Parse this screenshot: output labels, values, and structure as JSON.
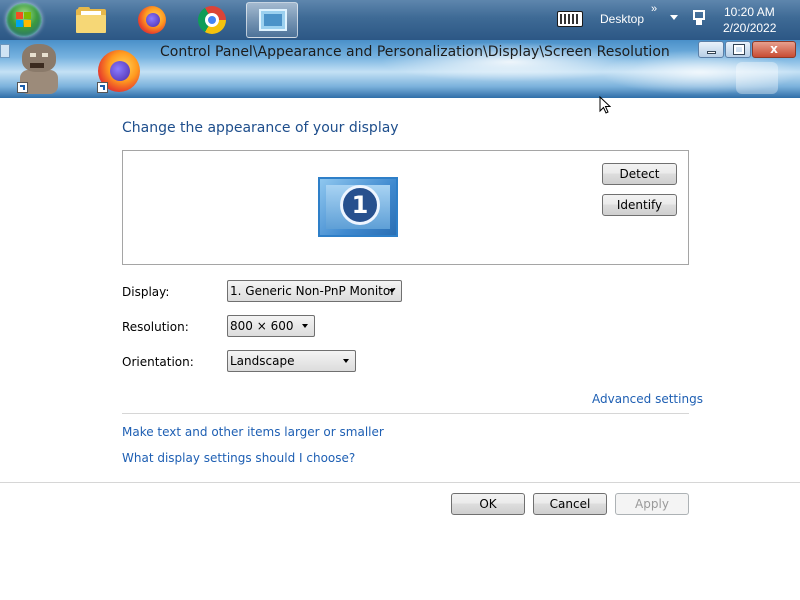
{
  "taskbar": {
    "pinned": [
      "start-button",
      "windows-explorer",
      "firefox",
      "chrome",
      "display-control-panel"
    ],
    "tray": {
      "desktop_label": "Desktop",
      "chevron": "»",
      "time": "10:20 AM",
      "date": "2/20/2022"
    }
  },
  "window": {
    "address": "Control Panel\\Appearance and Personalization\\Display\\Screen Resolution",
    "close_glyph": "x"
  },
  "content": {
    "title": "Change the appearance of your display",
    "monitor_number": "1",
    "detect_label": "Detect",
    "identify_label": "Identify",
    "display_label": "Display:",
    "display_value": "1. Generic Non-PnP Monitor",
    "resolution_label": "Resolution:",
    "resolution_value": "800 × 600",
    "orientation_label": "Orientation:",
    "orientation_value": "Landscape",
    "advanced_link": "Advanced settings",
    "text_size_link": "Make text and other items larger or smaller",
    "help_link": "What display settings should I choose?"
  },
  "footer": {
    "ok_label": "OK",
    "cancel_label": "Cancel",
    "apply_label": "Apply",
    "apply_enabled": false
  },
  "colors": {
    "link": "#1e5fb3",
    "title": "#1e4e8c",
    "taskbar": "#3e6a95"
  }
}
